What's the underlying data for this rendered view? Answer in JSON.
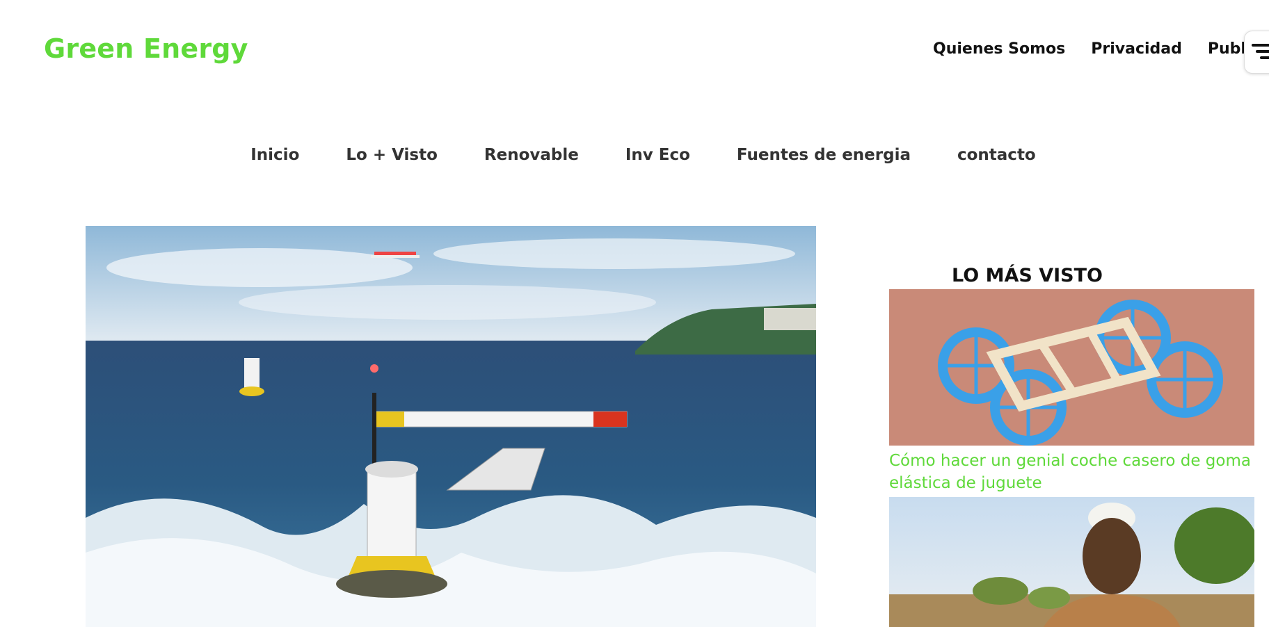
{
  "colors": {
    "accent": "#5fd93a",
    "text": "#111111",
    "nav_text": "#333333"
  },
  "header": {
    "brand": "Green Energy",
    "top_nav": [
      "Quienes Somos",
      "Privacidad",
      "Public"
    ]
  },
  "main_nav": [
    "Inicio",
    "Lo + Visto",
    "Renovable",
    "Inv Eco",
    "Fuentes de energia",
    "contacto"
  ],
  "icons": {
    "menu_toggle": "menu-icon"
  },
  "sidebar": {
    "title": "LO MÁS VISTO",
    "posts": [
      {
        "title": "Cómo hacer un genial coche casero de goma elástica de juguete"
      }
    ]
  }
}
